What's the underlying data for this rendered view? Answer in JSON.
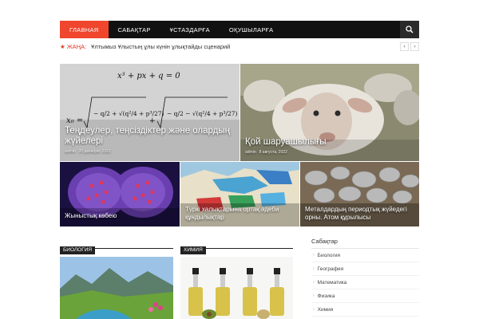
{
  "nav": {
    "items": [
      {
        "label": "ГЛАВНАЯ",
        "active": true
      },
      {
        "label": "САБАҚТАР",
        "active": false
      },
      {
        "label": "ҰСТАЗДАРҒА",
        "active": false
      },
      {
        "label": "ОҚУШЫЛАРҒА",
        "active": false
      }
    ],
    "search_icon": "search-icon"
  },
  "ticker": {
    "label": "ЖАҢА:",
    "text": "Ұлтымыз Ұлыстың ұлы күнін ұлықтайды сценарий"
  },
  "featured": [
    {
      "title": "Теңдеулер, теңсіздіктер және олардың жүйелері",
      "author": "admin",
      "date": "20 декабря, 2022"
    },
    {
      "title": "Қой шаруашылығы",
      "author": "admin",
      "date": "8 августа, 2022"
    },
    {
      "title": "Жыныстық көбею"
    },
    {
      "title": "Түркі халықтарына ортақ әдеби құндылықтар"
    },
    {
      "title": "Металдардың периодтық жүйедегі орны. Атом құрылысы"
    }
  ],
  "sections": {
    "biology": "БИОЛОГИЯ",
    "chemistry": "ХИМИЯ"
  },
  "sidebar": {
    "title": "Сабақтар",
    "items": [
      "Биология",
      "География",
      "Математика",
      "Физика",
      "Химия"
    ]
  },
  "colors": {
    "accent": "#f0462e",
    "nav_bg": "#111111"
  }
}
